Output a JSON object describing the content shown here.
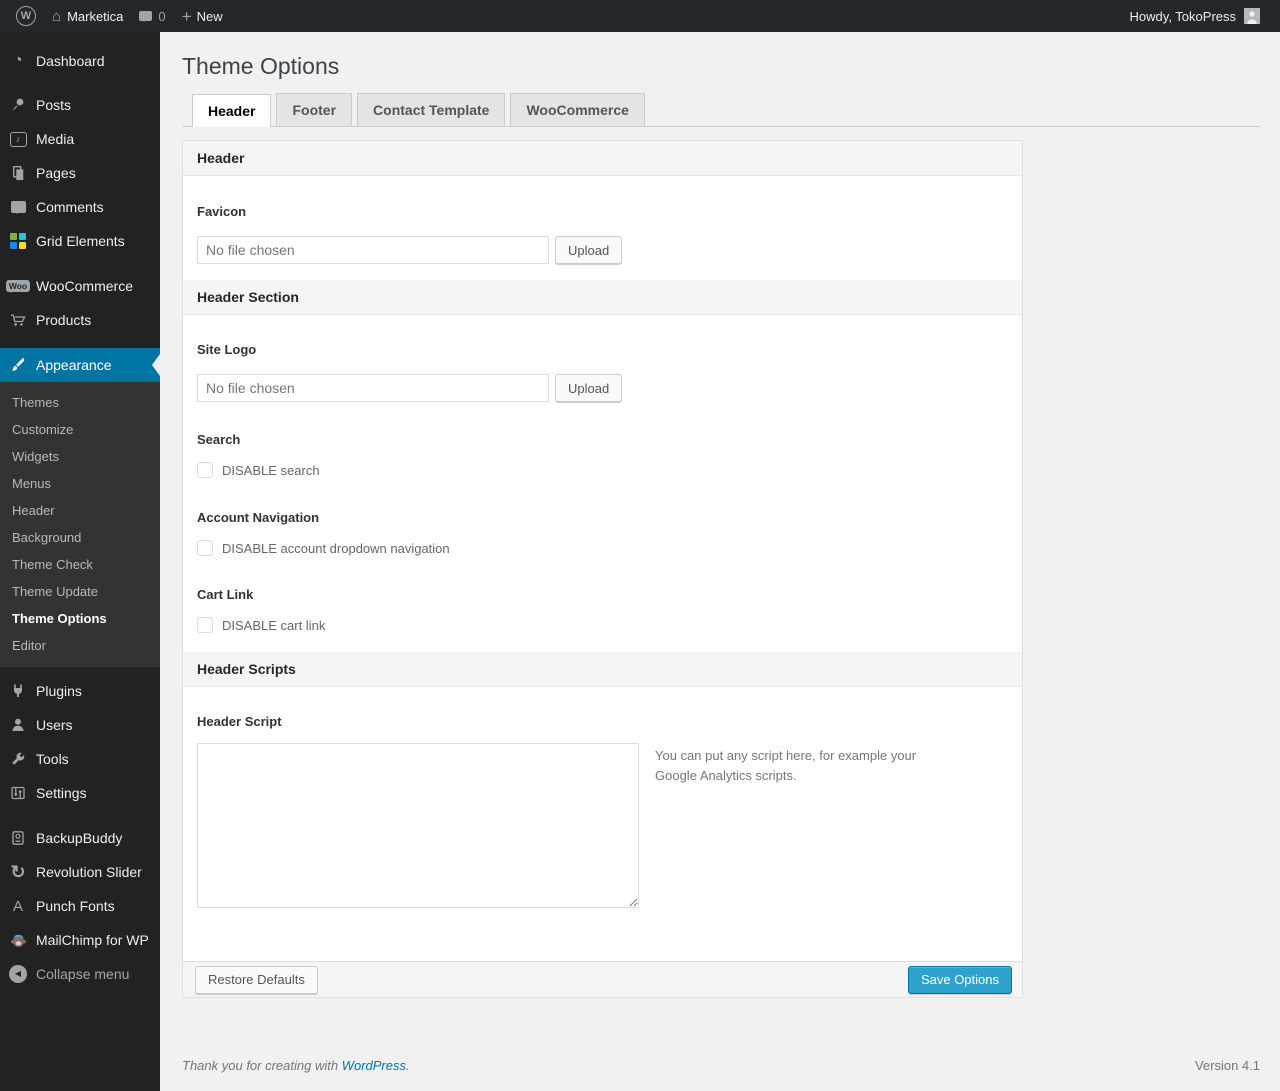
{
  "colors": {
    "accent": "#0074a2",
    "primary_button": "#2ea2cc",
    "admin_bar_bg": "#23282d",
    "menu_bg": "#222222",
    "page_bg": "#f1f1f1",
    "link": "#0074a2"
  },
  "admin_bar": {
    "logo_glyph": "W",
    "site_name": "Marketica",
    "comment_count": "0",
    "new_label": "New",
    "howdy_label": "Howdy, TokoPress"
  },
  "icons": {
    "home": "⌂",
    "plus": "+",
    "dashboard": "◔",
    "media_note": "♪",
    "revolution_slider": "↻",
    "punch_fonts_glyph": "A",
    "woocommerce_badge": "Woo",
    "collapse_arrow": "◀"
  },
  "sidebar": {
    "items": [
      {
        "label": "Dashboard"
      },
      {
        "label": "Posts"
      },
      {
        "label": "Media"
      },
      {
        "label": "Pages"
      },
      {
        "label": "Comments"
      },
      {
        "label": "Grid Elements"
      },
      {
        "label": "WooCommerce"
      },
      {
        "label": "Products"
      },
      {
        "label": "Appearance",
        "active": true
      },
      {
        "label": "Plugins"
      },
      {
        "label": "Users"
      },
      {
        "label": "Tools"
      },
      {
        "label": "Settings"
      },
      {
        "label": "BackupBuddy"
      },
      {
        "label": "Revolution Slider"
      },
      {
        "label": "Punch Fonts"
      },
      {
        "label": "MailChimp for WP"
      }
    ],
    "appearance_submenu": [
      "Themes",
      "Customize",
      "Widgets",
      "Menus",
      "Header",
      "Background",
      "Theme Check",
      "Theme Update",
      "Theme Options",
      "Editor"
    ],
    "current_submenu": "Theme Options",
    "collapse_label": "Collapse menu"
  },
  "page": {
    "title": "Theme Options",
    "tabs": [
      {
        "label": "Header",
        "active": true
      },
      {
        "label": "Footer",
        "active": false
      },
      {
        "label": "Contact Template",
        "active": false
      },
      {
        "label": "WooCommerce",
        "active": false
      }
    ]
  },
  "form": {
    "section_header": "Header",
    "section_header_section": "Header Section",
    "section_header_scripts": "Header Scripts",
    "favicon": {
      "label": "Favicon",
      "value": "No file chosen",
      "button": "Upload"
    },
    "site_logo": {
      "label": "Site Logo",
      "value": "No file chosen",
      "button": "Upload"
    },
    "search": {
      "label": "Search",
      "checkbox": "DISABLE search",
      "checked": false
    },
    "account_navigation": {
      "label": "Account Navigation",
      "checkbox": "DISABLE account dropdown navigation",
      "checked": false
    },
    "cart_link": {
      "label": "Cart Link",
      "checkbox": "DISABLE cart link",
      "checked": false
    },
    "header_script": {
      "label": "Header Script",
      "value": "",
      "description": "You can put any script here, for example your Google Analytics scripts."
    },
    "actions": {
      "restore": "Restore Defaults",
      "save": "Save Options"
    }
  },
  "footer": {
    "thanks_prefix": "Thank you for creating with ",
    "link_text": "WordPress",
    "thanks_suffix": ".",
    "version": "Version 4.1"
  }
}
